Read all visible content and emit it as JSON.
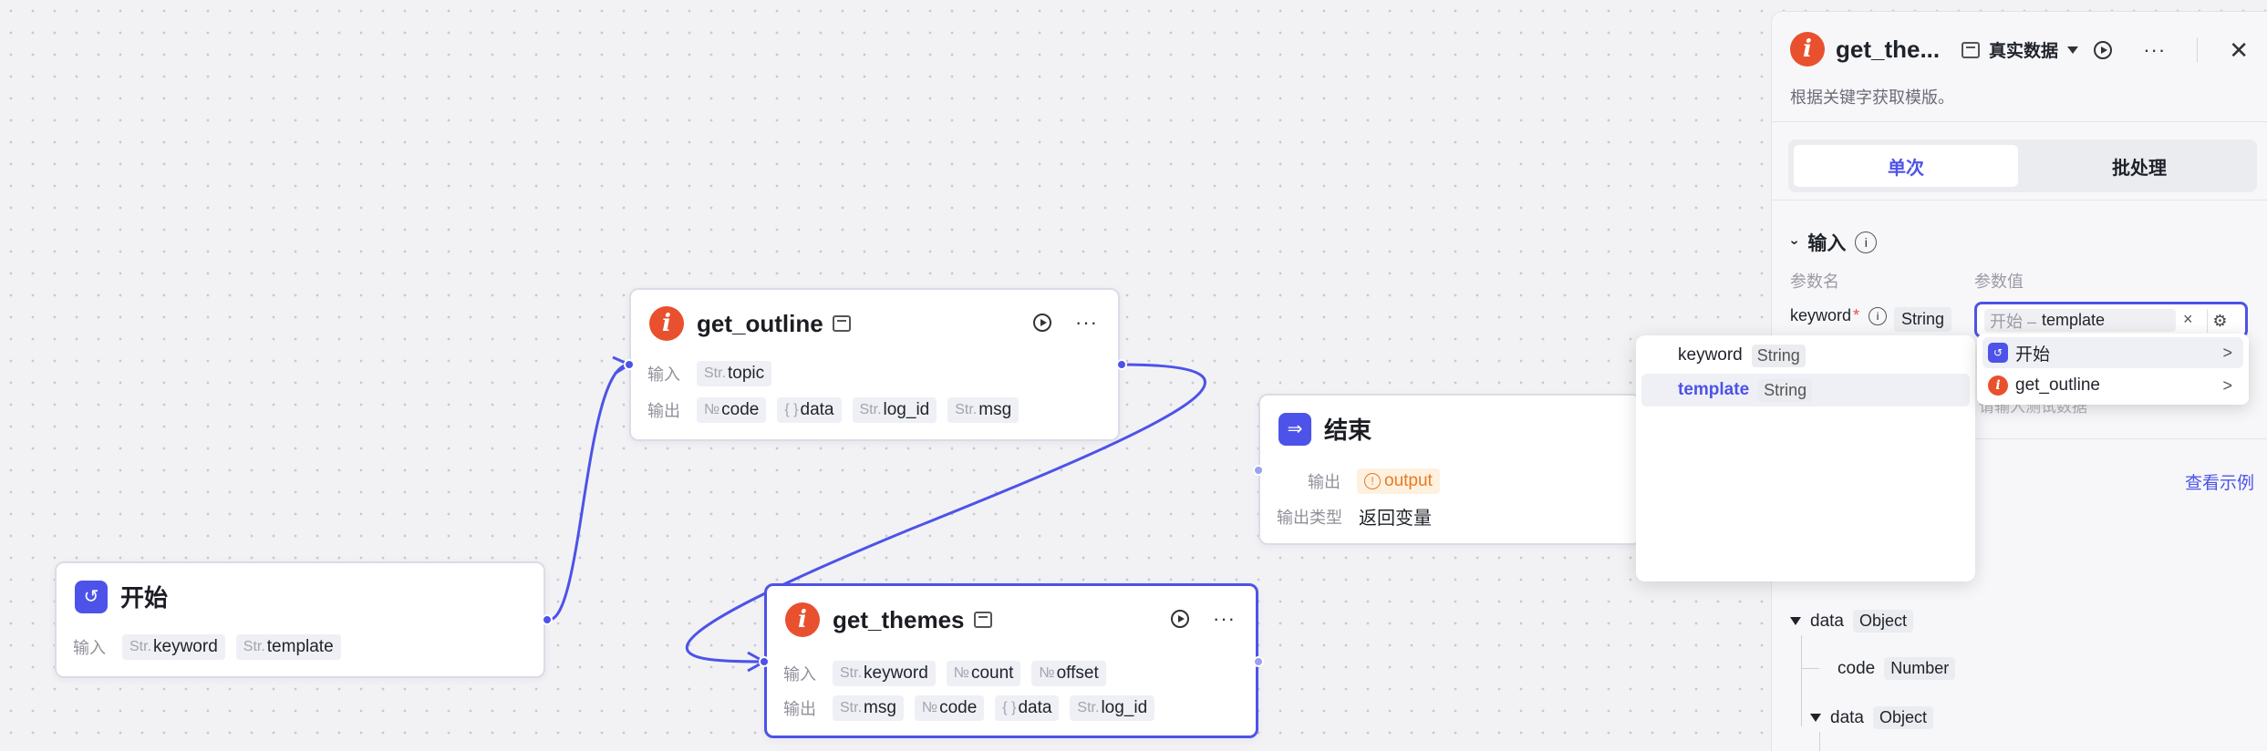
{
  "nodes": {
    "start": {
      "title": "开始",
      "input_label": "输入",
      "inputs": [
        {
          "type": "Str.",
          "name": "keyword"
        },
        {
          "type": "Str.",
          "name": "template"
        }
      ]
    },
    "get_outline": {
      "title": "get_outline",
      "input_label": "输入",
      "output_label": "输出",
      "inputs": [
        {
          "type": "Str.",
          "name": "topic"
        }
      ],
      "outputs": [
        {
          "type": "№",
          "name": "code"
        },
        {
          "type": "{ }",
          "name": "data"
        },
        {
          "type": "Str.",
          "name": "log_id"
        },
        {
          "type": "Str.",
          "name": "msg"
        }
      ]
    },
    "get_themes": {
      "title": "get_themes",
      "input_label": "输入",
      "output_label": "输出",
      "inputs": [
        {
          "type": "Str.",
          "name": "keyword"
        },
        {
          "type": "№",
          "name": "count"
        },
        {
          "type": "№",
          "name": "offset"
        }
      ],
      "outputs": [
        {
          "type": "Str.",
          "name": "msg"
        },
        {
          "type": "№",
          "name": "code"
        },
        {
          "type": "{ }",
          "name": "data"
        },
        {
          "type": "Str.",
          "name": "log_id"
        }
      ]
    },
    "end": {
      "title": "结束",
      "output_label": "输出",
      "output_value": "output",
      "output_type_label": "输出类型",
      "output_type_value": "返回变量"
    }
  },
  "panel": {
    "title": "get_the...",
    "data_mode": "真实数据",
    "description": "根据关键字获取模版。",
    "tabs": [
      "单次",
      "批处理"
    ],
    "section_title": "输入",
    "col_name": "参数名",
    "col_value": "参数值",
    "param_name": "keyword",
    "param_type": "String",
    "value_chip_source": "开始 –",
    "value_chip_var": "template",
    "view_example": "查看示例",
    "ghost_text": "请输入测试数据",
    "tree": [
      {
        "name": "data",
        "type": "Object"
      },
      {
        "name": "code",
        "type": "Number"
      },
      {
        "name": "data",
        "type": "Object"
      }
    ]
  },
  "var_popup": {
    "items": [
      {
        "name": "keyword",
        "type": "String"
      },
      {
        "name": "template",
        "type": "String"
      }
    ]
  },
  "node_popup": {
    "items": [
      {
        "name": "开始"
      },
      {
        "name": "get_outline"
      }
    ]
  },
  "colors": {
    "accent": "#4d53e8",
    "plugin": "#e9502d",
    "warn": "#e8791f"
  }
}
